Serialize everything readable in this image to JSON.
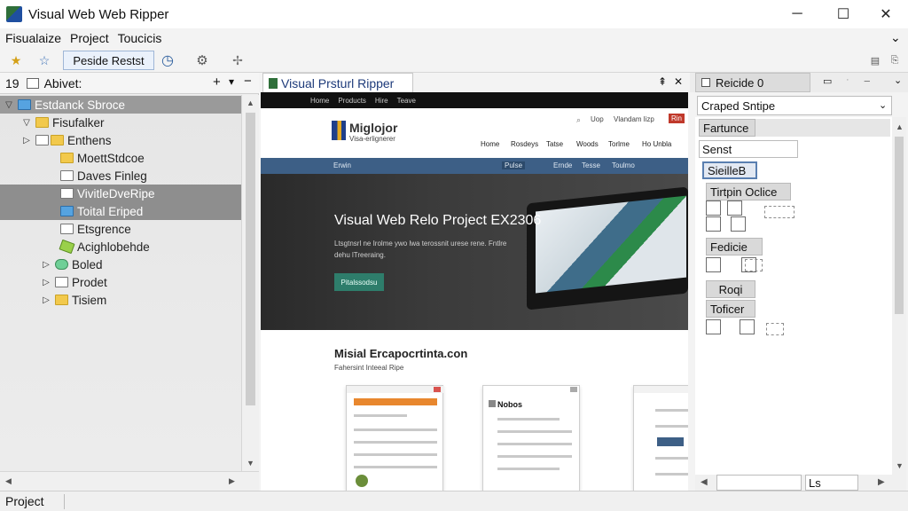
{
  "window": {
    "title": "Visual Web Web Ripper",
    "minimize": "─",
    "maximize": "☐",
    "close": "✕"
  },
  "menu": [
    "Fisualaize",
    "Project",
    "Toucicis"
  ],
  "toolbar": {
    "active_label": "Peside Restst"
  },
  "left_panel": {
    "count": "19",
    "header_label": "Abivet:",
    "add": "+",
    "dropdown": "▾",
    "collapse": "−",
    "tree": [
      {
        "label": "Estdanck Sbroce",
        "twisty": "▽",
        "icon": "folder-blue-icon",
        "indent": 0
      },
      {
        "label": "Fisufalker",
        "twisty": "▽",
        "icon": "folder-icon",
        "indent": 1
      },
      {
        "label": "Enthens",
        "twisty": "▷",
        "icon": "folder-icon",
        "indent": 2
      },
      {
        "label": "MoettStdcoe",
        "twisty": "",
        "icon": "folder-icon",
        "indent": 3
      },
      {
        "label": "Daves Finleg",
        "twisty": "",
        "icon": "file-icon",
        "indent": 3
      },
      {
        "label": "VivitleDveRipe",
        "twisty": "",
        "icon": "file-icon",
        "indent": 3
      },
      {
        "label": "Toital Eriped",
        "twisty": "",
        "icon": "blue-page-icon",
        "indent": 3
      },
      {
        "label": "Etsgrence",
        "twisty": "",
        "icon": "file-icon",
        "indent": 3
      },
      {
        "label": "Acighlobehde",
        "twisty": "",
        "icon": "leaf-icon",
        "indent": 3
      },
      {
        "label": "Boled",
        "twisty": "▷",
        "icon": "database-icon",
        "indent": 2
      },
      {
        "label": "Prodet",
        "twisty": "▷",
        "icon": "file-icon",
        "indent": 2
      },
      {
        "label": "Tisiem",
        "twisty": "▷",
        "icon": "folder-icon",
        "indent": 2
      }
    ]
  },
  "center_panel": {
    "tab_label": "Visual Prsturl Ripper",
    "pin": "⇞",
    "close": "✕",
    "site": {
      "topnav": [
        "Home",
        "Products",
        "Hire",
        "Teave"
      ],
      "logo_text": "Miglojor",
      "logo_sub": "Visa-erlignerer",
      "top_links": [
        "Uop",
        "Vlandam lizp",
        "Rin"
      ],
      "nav": [
        "Home",
        "Rosdeys",
        "Tatse",
        "Woods",
        "Torlme",
        "Ho Unbla"
      ],
      "bar_left": "Erwin",
      "bar_links": [
        "Pulse",
        "Ernde",
        "Tesse",
        "Toulmo"
      ],
      "hero_title": "Visual Web Relo Project EX2306",
      "hero_sub": "Ltsgtnsrl ne Irolme ywo lwa terossnit urese rene. Fntlre dehu lTreeraing.",
      "hero_button": "Pitalssodsu",
      "section_title": "Misial Ercapocrtinta.con",
      "section_sub": "Fahersint Inteeal Ripe",
      "card2_title": "Nobos"
    }
  },
  "right_panel": {
    "tab_label": "Reicide 0",
    "dropdown_value": "Craped Sntipe",
    "props": {
      "fartunce": "Fartunce",
      "senst": "Senst",
      "sieiileb": "SieilleB",
      "tirtpin": "Tirtpin Oclice",
      "fedicie": "Fedicie",
      "roqi": "Roqi",
      "toficer": "Toficer"
    },
    "bottom_field": "Ls"
  },
  "status": {
    "text": "Project"
  },
  "colors": {
    "accent": "#3d5f86",
    "hero_button": "#2e7d6b",
    "selection": "#9a9a9a"
  }
}
